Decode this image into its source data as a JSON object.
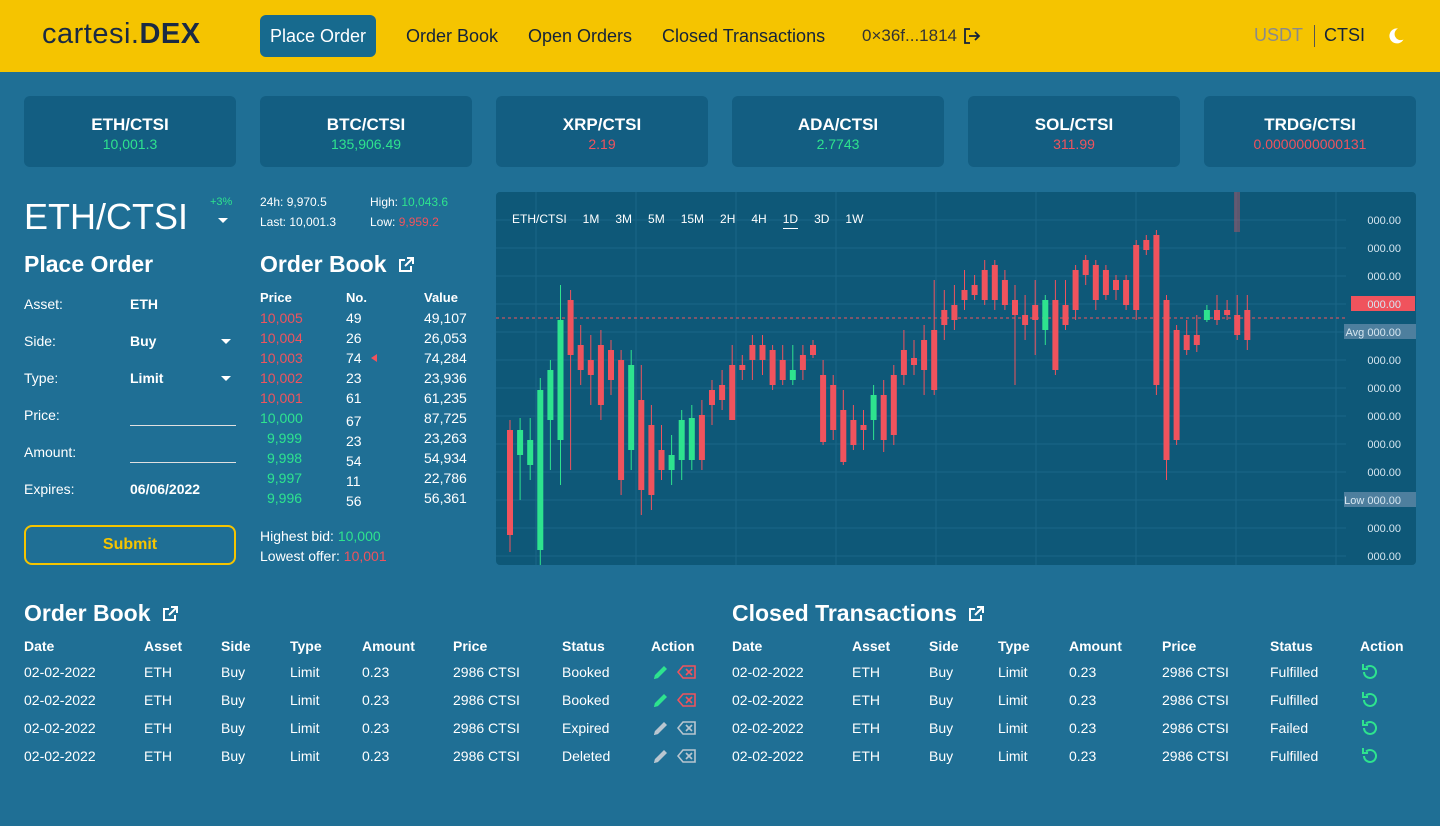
{
  "header": {
    "logo_light": "cartesi.",
    "logo_bold": "DEX",
    "nav": [
      "Place Order",
      "Order Book",
      "Open Orders",
      "Closed Transactions"
    ],
    "wallet": "0×36f...1814",
    "currency_usdt": "USDT",
    "currency_ctsi": "CTSI"
  },
  "tickers": [
    {
      "name": "ETH/CTSI",
      "value": "10,001.3",
      "trend": "up"
    },
    {
      "name": "BTC/CTSI",
      "value": "135,906.49",
      "trend": "up"
    },
    {
      "name": "XRP/CTSI",
      "value": "2.19",
      "trend": "down"
    },
    {
      "name": "ADA/CTSI",
      "value": "2.7743",
      "trend": "up"
    },
    {
      "name": "SOL/CTSI",
      "value": "311.99",
      "trend": "down"
    },
    {
      "name": "TRDG/CTSI",
      "value": "0.0000000000131",
      "trend": "down"
    }
  ],
  "pair": {
    "title": "ETH/CTSI",
    "change": "+3%",
    "h24_label": "24h:",
    "h24": "9,970.5",
    "last_label": "Last:",
    "last": "10,001.3",
    "high_label": "High:",
    "high": "10,043.6",
    "low_label": "Low:",
    "low": "9,959.2"
  },
  "place_order": {
    "title": "Place Order",
    "asset_label": "Asset:",
    "asset": "ETH",
    "side_label": "Side:",
    "side": "Buy",
    "type_label": "Type:",
    "type": "Limit",
    "price_label": "Price:",
    "price": "",
    "amount_label": "Amount:",
    "amount": "",
    "expires_label": "Expires:",
    "expires": "06/06/2022",
    "submit": "Submit"
  },
  "order_book": {
    "title": "Order Book",
    "headers": [
      "Price",
      "No.",
      "Value"
    ],
    "rows": [
      {
        "price": "10,005",
        "no": "49",
        "value": "49,107",
        "side": "ask"
      },
      {
        "price": "10,004",
        "no": "26",
        "value": "26,053",
        "side": "ask"
      },
      {
        "price": "10,003",
        "no": "74",
        "value": "74,284",
        "side": "ask"
      },
      {
        "price": "10,002",
        "no": "23",
        "value": "23,936",
        "side": "ask"
      },
      {
        "price": "10,001",
        "no": "61",
        "value": "61,235",
        "side": "ask"
      },
      {
        "price": "10,000",
        "no": "67",
        "value": "87,725",
        "side": "bid"
      },
      {
        "price": "9,999",
        "no": "23",
        "value": "23,263",
        "side": "bid"
      },
      {
        "price": "9,998",
        "no": "54",
        "value": "54,934",
        "side": "bid"
      },
      {
        "price": "9,997",
        "no": "11",
        "value": "22,786",
        "side": "bid"
      },
      {
        "price": "9,996",
        "no": "56",
        "value": "56,361",
        "side": "bid"
      }
    ],
    "highest_bid_label": "Highest bid:",
    "highest_bid": "10,000",
    "lowest_offer_label": "Lowest offer:",
    "lowest_offer": "10,001"
  },
  "chart": {
    "pair": "ETH/CTSI",
    "intervals": [
      "1M",
      "3M",
      "5M",
      "15M",
      "2H",
      "4H",
      "1D",
      "3D",
      "1W"
    ],
    "active_interval": "1D",
    "axis_labels": [
      "000.00",
      "000.00",
      "000.00",
      "000.00",
      "000.00",
      "000.00",
      "000.00",
      "000.00",
      "000.00",
      "000.00",
      "000.00",
      "000.00",
      "000.00"
    ],
    "avg_label": "Avg",
    "low_label": "Low",
    "colors": {
      "up": "#2ee38e",
      "down": "#f0535d"
    }
  },
  "chart_data": {
    "type": "candlestick",
    "interval": "1D",
    "candles": [
      {
        "o": 430,
        "c": 535,
        "h": 420,
        "l": 552
      },
      {
        "o": 455,
        "c": 430,
        "h": 418,
        "l": 500
      },
      {
        "o": 465,
        "c": 440,
        "h": 418,
        "l": 480
      },
      {
        "o": 550,
        "c": 390,
        "h": 378,
        "l": 565
      },
      {
        "o": 420,
        "c": 370,
        "h": 360,
        "l": 470
      },
      {
        "o": 440,
        "c": 320,
        "h": 285,
        "l": 485
      },
      {
        "o": 300,
        "c": 355,
        "h": 290,
        "l": 470
      },
      {
        "o": 345,
        "c": 370,
        "h": 325,
        "l": 385
      },
      {
        "o": 360,
        "c": 375,
        "h": 335,
        "l": 405
      },
      {
        "o": 345,
        "c": 405,
        "h": 330,
        "l": 420
      },
      {
        "o": 350,
        "c": 380,
        "h": 340,
        "l": 395
      },
      {
        "o": 360,
        "c": 480,
        "h": 350,
        "l": 495
      },
      {
        "o": 450,
        "c": 365,
        "h": 350,
        "l": 470
      },
      {
        "o": 400,
        "c": 490,
        "h": 365,
        "l": 515
      },
      {
        "o": 425,
        "c": 495,
        "h": 405,
        "l": 510
      },
      {
        "o": 450,
        "c": 470,
        "h": 425,
        "l": 480
      },
      {
        "o": 470,
        "c": 455,
        "h": 435,
        "l": 485
      },
      {
        "o": 460,
        "c": 420,
        "h": 410,
        "l": 480
      },
      {
        "o": 460,
        "c": 418,
        "h": 405,
        "l": 470
      },
      {
        "o": 415,
        "c": 460,
        "h": 400,
        "l": 470
      },
      {
        "o": 390,
        "c": 405,
        "h": 380,
        "l": 425
      },
      {
        "o": 385,
        "c": 400,
        "h": 370,
        "l": 410
      },
      {
        "o": 365,
        "c": 420,
        "h": 345,
        "l": 420
      },
      {
        "o": 365,
        "c": 370,
        "h": 355,
        "l": 380
      },
      {
        "o": 345,
        "c": 360,
        "h": 335,
        "l": 380
      },
      {
        "o": 345,
        "c": 360,
        "h": 335,
        "l": 375
      },
      {
        "o": 350,
        "c": 385,
        "h": 345,
        "l": 390
      },
      {
        "o": 360,
        "c": 380,
        "h": 345,
        "l": 385
      },
      {
        "o": 380,
        "c": 370,
        "h": 345,
        "l": 385
      },
      {
        "o": 355,
        "c": 370,
        "h": 345,
        "l": 380
      },
      {
        "o": 345,
        "c": 355,
        "h": 340,
        "l": 358
      },
      {
        "o": 375,
        "c": 442,
        "h": 360,
        "l": 445
      },
      {
        "o": 385,
        "c": 430,
        "h": 375,
        "l": 440
      },
      {
        "o": 410,
        "c": 462,
        "h": 390,
        "l": 465
      },
      {
        "o": 420,
        "c": 445,
        "h": 405,
        "l": 450
      },
      {
        "o": 425,
        "c": 430,
        "h": 410,
        "l": 450
      },
      {
        "o": 420,
        "c": 395,
        "h": 385,
        "l": 440
      },
      {
        "o": 395,
        "c": 440,
        "h": 380,
        "l": 452
      },
      {
        "o": 375,
        "c": 435,
        "h": 365,
        "l": 445
      },
      {
        "o": 350,
        "c": 375,
        "h": 330,
        "l": 385
      },
      {
        "o": 358,
        "c": 365,
        "h": 340,
        "l": 375
      },
      {
        "o": 340,
        "c": 370,
        "h": 325,
        "l": 395
      },
      {
        "o": 330,
        "c": 390,
        "h": 280,
        "l": 395
      },
      {
        "o": 310,
        "c": 325,
        "h": 290,
        "l": 340
      },
      {
        "o": 305,
        "c": 320,
        "h": 285,
        "l": 330
      },
      {
        "o": 290,
        "c": 300,
        "h": 270,
        "l": 310
      },
      {
        "o": 285,
        "c": 295,
        "h": 275,
        "l": 300
      },
      {
        "o": 270,
        "c": 300,
        "h": 260,
        "l": 305
      },
      {
        "o": 265,
        "c": 300,
        "h": 260,
        "l": 310
      },
      {
        "o": 280,
        "c": 305,
        "h": 270,
        "l": 310
      },
      {
        "o": 300,
        "c": 315,
        "h": 285,
        "l": 385
      },
      {
        "o": 315,
        "c": 325,
        "h": 295,
        "l": 340
      },
      {
        "o": 305,
        "c": 320,
        "h": 280,
        "l": 355
      },
      {
        "o": 330,
        "c": 300,
        "h": 295,
        "l": 345
      },
      {
        "o": 300,
        "c": 370,
        "h": 280,
        "l": 375
      },
      {
        "o": 305,
        "c": 325,
        "h": 280,
        "l": 330
      },
      {
        "o": 270,
        "c": 310,
        "h": 265,
        "l": 320
      },
      {
        "o": 260,
        "c": 275,
        "h": 255,
        "l": 285
      },
      {
        "o": 265,
        "c": 300,
        "h": 260,
        "l": 310
      },
      {
        "o": 270,
        "c": 295,
        "h": 265,
        "l": 300
      },
      {
        "o": 280,
        "c": 290,
        "h": 275,
        "l": 300
      },
      {
        "o": 280,
        "c": 305,
        "h": 275,
        "l": 310
      },
      {
        "o": 245,
        "c": 310,
        "h": 240,
        "l": 320
      },
      {
        "o": 240,
        "c": 250,
        "h": 235,
        "l": 255
      },
      {
        "o": 235,
        "c": 385,
        "h": 230,
        "l": 395
      },
      {
        "o": 300,
        "c": 460,
        "h": 295,
        "l": 480
      },
      {
        "o": 330,
        "c": 440,
        "h": 325,
        "l": 445
      },
      {
        "o": 335,
        "c": 350,
        "h": 320,
        "l": 355
      },
      {
        "o": 335,
        "c": 345,
        "h": 315,
        "l": 352
      },
      {
        "o": 320,
        "c": 310,
        "h": 305,
        "l": 322
      },
      {
        "o": 310,
        "c": 320,
        "h": 295,
        "l": 325
      },
      {
        "o": 310,
        "c": 315,
        "h": 300,
        "l": 320
      },
      {
        "o": 315,
        "c": 335,
        "h": 295,
        "l": 340
      },
      {
        "o": 310,
        "c": 340,
        "h": 295,
        "l": 350
      }
    ]
  },
  "open_orders_table": {
    "title": "Order Book",
    "headers": [
      "Date",
      "Asset",
      "Side",
      "Type",
      "Amount",
      "Price",
      "Status",
      "Action"
    ],
    "rows": [
      {
        "date": "02-02-2022",
        "asset": "ETH",
        "side": "Buy",
        "type": "Limit",
        "amount": "0.23",
        "price": "2986 CTSI",
        "status": "Booked",
        "active": true
      },
      {
        "date": "02-02-2022",
        "asset": "ETH",
        "side": "Buy",
        "type": "Limit",
        "amount": "0.23",
        "price": "2986 CTSI",
        "status": "Booked",
        "active": true
      },
      {
        "date": "02-02-2022",
        "asset": "ETH",
        "side": "Buy",
        "type": "Limit",
        "amount": "0.23",
        "price": "2986 CTSI",
        "status": "Expired",
        "active": false
      },
      {
        "date": "02-02-2022",
        "asset": "ETH",
        "side": "Buy",
        "type": "Limit",
        "amount": "0.23",
        "price": "2986 CTSI",
        "status": "Deleted",
        "active": false
      }
    ]
  },
  "closed_table": {
    "title": "Closed Transactions",
    "headers": [
      "Date",
      "Asset",
      "Side",
      "Type",
      "Amount",
      "Price",
      "Status",
      "Action"
    ],
    "rows": [
      {
        "date": "02-02-2022",
        "asset": "ETH",
        "side": "Buy",
        "type": "Limit",
        "amount": "0.23",
        "price": "2986 CTSI",
        "status": "Fulfilled"
      },
      {
        "date": "02-02-2022",
        "asset": "ETH",
        "side": "Buy",
        "type": "Limit",
        "amount": "0.23",
        "price": "2986 CTSI",
        "status": "Fulfilled"
      },
      {
        "date": "02-02-2022",
        "asset": "ETH",
        "side": "Buy",
        "type": "Limit",
        "amount": "0.23",
        "price": "2986 CTSI",
        "status": "Failed"
      },
      {
        "date": "02-02-2022",
        "asset": "ETH",
        "side": "Buy",
        "type": "Limit",
        "amount": "0.23",
        "price": "2986 CTSI",
        "status": "Fulfilled"
      }
    ]
  }
}
